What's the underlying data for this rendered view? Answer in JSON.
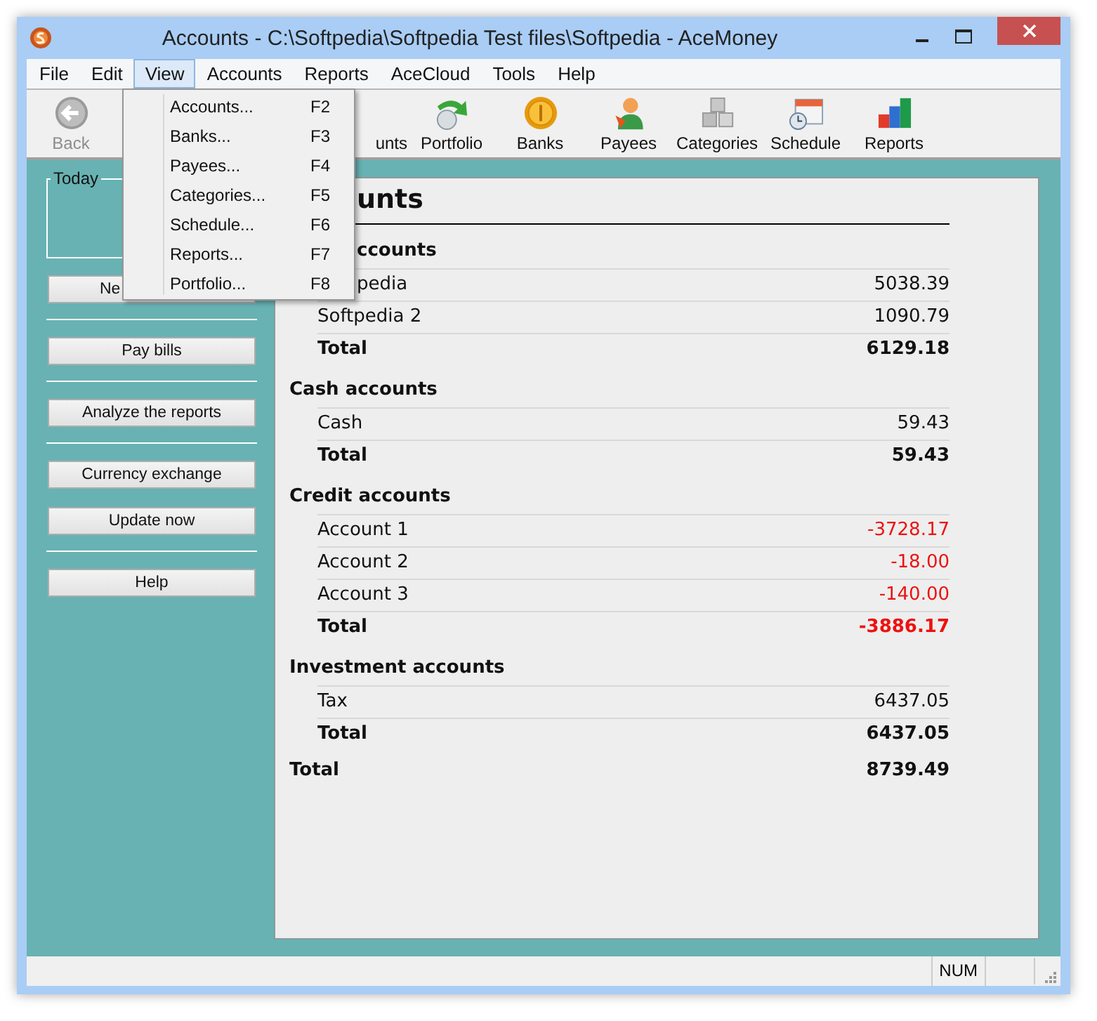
{
  "window": {
    "title": "Accounts - C:\\Softpedia\\Softpedia Test files\\Softpedia - AceMoney"
  },
  "menu_bar": [
    {
      "label": "File",
      "selected": false
    },
    {
      "label": "Edit",
      "selected": false
    },
    {
      "label": "View",
      "selected": true
    },
    {
      "label": "Accounts",
      "selected": false
    },
    {
      "label": "Reports",
      "selected": false
    },
    {
      "label": "AceCloud",
      "selected": false
    },
    {
      "label": "Tools",
      "selected": false
    },
    {
      "label": "Help",
      "selected": false
    }
  ],
  "open_menu": {
    "items": [
      {
        "label": "Accounts...",
        "shortcut": "F2"
      },
      {
        "label": "Banks...",
        "shortcut": "F3"
      },
      {
        "label": "Payees...",
        "shortcut": "F4"
      },
      {
        "label": "Categories...",
        "shortcut": "F5"
      },
      {
        "label": "Schedule...",
        "shortcut": "F6"
      },
      {
        "label": "Reports...",
        "shortcut": "F7"
      },
      {
        "label": "Portfolio...",
        "shortcut": "F8"
      }
    ]
  },
  "toolbar": [
    {
      "label": "Back",
      "kind": "back",
      "disabled": true,
      "covered": false
    },
    {
      "label": "unts",
      "kind": "none",
      "disabled": false,
      "covered": true
    },
    {
      "label": "Portfolio",
      "kind": "portfolio",
      "disabled": false,
      "covered": false
    },
    {
      "label": "Banks",
      "kind": "banks",
      "disabled": false,
      "covered": false
    },
    {
      "label": "Payees",
      "kind": "payees",
      "disabled": false,
      "covered": false
    },
    {
      "label": "Categories",
      "kind": "categories",
      "disabled": false,
      "covered": false
    },
    {
      "label": "Schedule",
      "kind": "schedule",
      "disabled": false,
      "covered": false
    },
    {
      "label": "Reports",
      "kind": "reports",
      "disabled": false,
      "covered": false
    }
  ],
  "sidebar": {
    "today_box": {
      "label": "Today"
    },
    "button_groups": [
      [
        {
          "label": "Ne",
          "covered": true
        }
      ],
      [
        {
          "label": "Pay bills",
          "covered": false
        }
      ],
      [
        {
          "label": "Analyze the reports",
          "covered": false
        }
      ],
      [
        {
          "label": "Currency exchange",
          "covered": false
        },
        {
          "label": "Update now",
          "covered": false
        }
      ],
      [
        {
          "label": "Help",
          "covered": false
        }
      ]
    ]
  },
  "report": {
    "heading": "unts",
    "heading_covered": true,
    "sections": [
      {
        "title": "ccounts",
        "covered": true,
        "rows": [
          {
            "name": "pedia",
            "value": "5038.39",
            "negative": false,
            "covered": true
          },
          {
            "name": "Softpedia 2",
            "value": "1090.79",
            "negative": false
          }
        ],
        "total_label": "Total",
        "total": "6129.18",
        "total_negative": false
      },
      {
        "title": "Cash accounts",
        "covered": false,
        "rows": [
          {
            "name": "Cash",
            "value": "59.43",
            "negative": false
          }
        ],
        "total_label": "Total",
        "total": "59.43",
        "total_negative": false
      },
      {
        "title": "Credit accounts",
        "covered": false,
        "rows": [
          {
            "name": "Account 1",
            "value": "-3728.17",
            "negative": true
          },
          {
            "name": "Account 2",
            "value": "-18.00",
            "negative": true
          },
          {
            "name": "Account 3",
            "value": "-140.00",
            "negative": true
          }
        ],
        "total_label": "Total",
        "total": "-3886.17",
        "total_negative": true
      },
      {
        "title": "Investment accounts",
        "covered": false,
        "rows": [
          {
            "name": "Tax",
            "value": "6437.05",
            "negative": false
          }
        ],
        "total_label": "Total",
        "total": "6437.05",
        "total_negative": false
      }
    ],
    "grand_total_label": "Total",
    "grand_total": "8739.49"
  },
  "status_bar": {
    "indicator": "NUM"
  }
}
